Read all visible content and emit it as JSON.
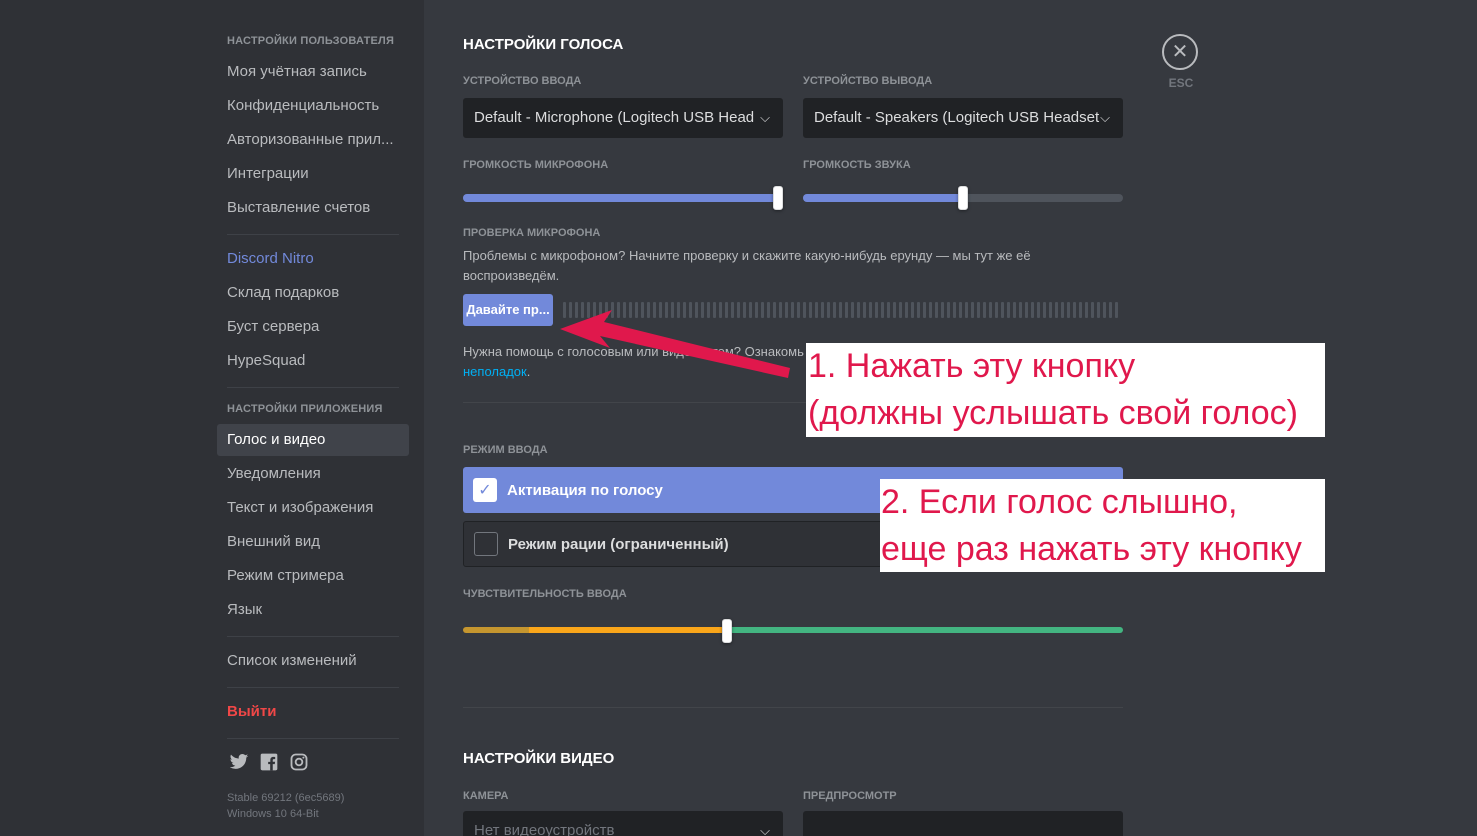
{
  "sidebar": {
    "user_settings_header": "Настройки пользователя",
    "user_items": [
      "Моя учётная запись",
      "Конфиденциальность",
      "Авторизованные прил...",
      "Интеграции",
      "Выставление счетов"
    ],
    "nitro_items": [
      "Discord Nitro",
      "Склад подарков",
      "Буст сервера",
      "HypeSquad"
    ],
    "app_settings_header": "Настройки приложения",
    "app_items": [
      "Голос и видео",
      "Уведомления",
      "Текст и изображения",
      "Внешний вид",
      "Режим стримера",
      "Язык"
    ],
    "changelog": "Список изменений",
    "logout": "Выйти",
    "social_icons": [
      "twitter-icon",
      "facebook-icon",
      "instagram-icon"
    ],
    "version_line1": "Stable 69212 (6ec5689)",
    "version_line2": "Windows 10 64-Bit"
  },
  "voice": {
    "title": "Настройки голоса",
    "input_device_label": "Устройство ввода",
    "input_device_value": "Default - Microphone (Logitech USB Head",
    "output_device_label": "Устройство вывода",
    "output_device_value": "Default - Speakers (Logitech USB Headset",
    "mic_volume_label": "Громкость микрофона",
    "mic_volume_level": 1.0,
    "output_volume_label": "Громкость звука",
    "output_volume_level": 0.5,
    "mic_test_label": "Проверка микрофона",
    "mic_test_desc": "Проблемы с микрофоном? Начните проверку и скажите какую-нибудь ерунду — мы тут же её воспроизведём.",
    "mic_test_button": "Давайте пр...",
    "help_text": "Нужна помощь с голосовым или видеочатом? Ознакомь",
    "help_link": "неполадок",
    "help_end": ".",
    "input_mode_label": "Режим ввода",
    "input_mode_voice": "Активация по голосу",
    "input_mode_ptt": "Режим рации (ограниченный)",
    "sensitivity_label": "Чувствительность ввода",
    "sensitivity_level": 0.4
  },
  "video": {
    "title": "Настройки видео",
    "camera_label": "Камера",
    "camera_value": "Нет видеоустройств",
    "preview_label": "Предпросмотр"
  },
  "close": {
    "icon": "close-icon",
    "label": "ESC"
  },
  "annotations": {
    "note1_line1": "1. Нажать эту кнопку",
    "note1_line2": "(должны услышать свой голос)",
    "note2_line1": "2. Если голос слышно,",
    "note2_line2": "еще раз нажать эту кнопку",
    "color": "#e0184c"
  },
  "colors": {
    "accent": "#7289da",
    "danger": "#f04747",
    "link": "#00b0f4",
    "sens_low": "#c5962f",
    "sens_mid": "#faa61a",
    "sens_high": "#43b581"
  }
}
